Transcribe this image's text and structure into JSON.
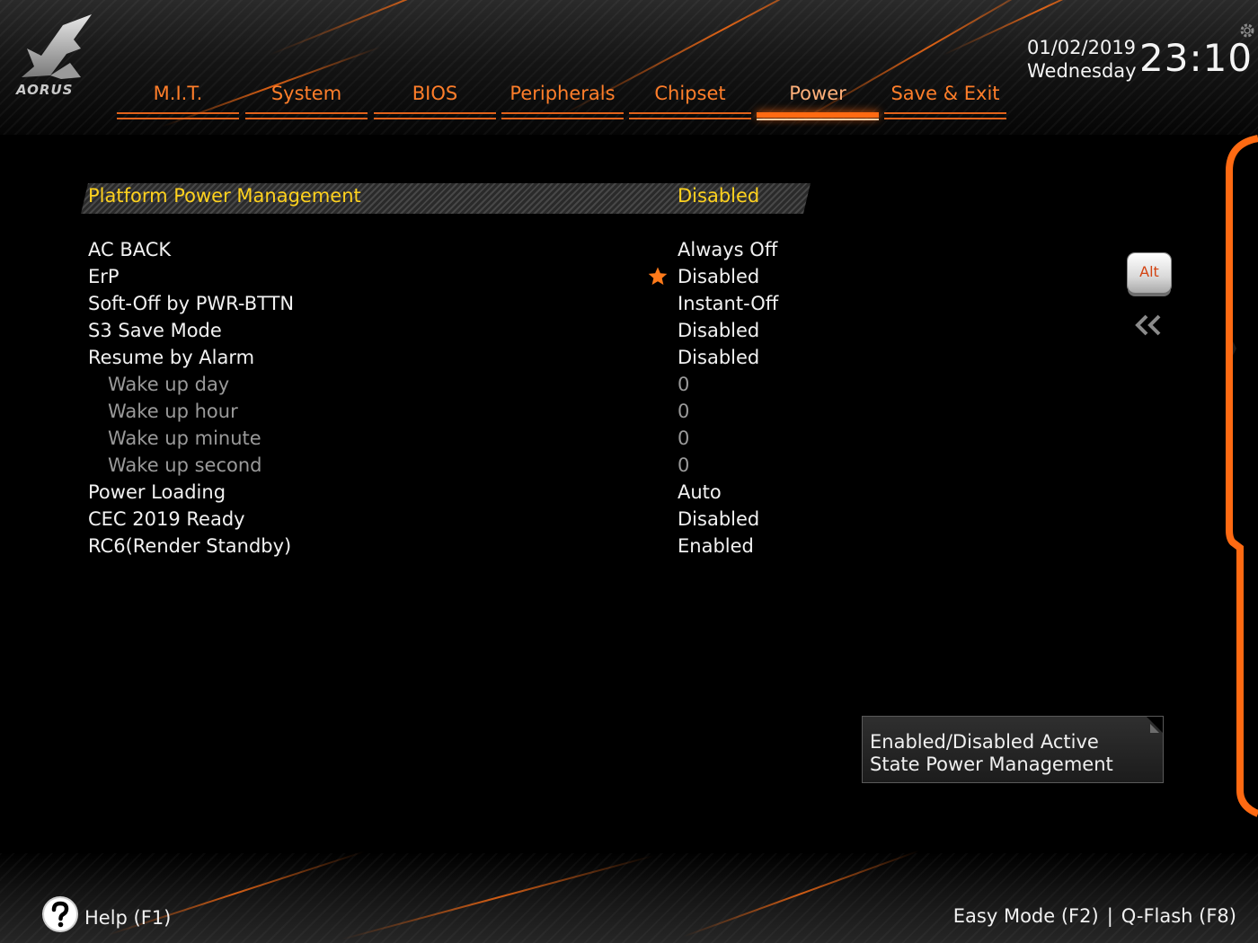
{
  "brand": {
    "logo_text": "AORUS"
  },
  "tabs": [
    {
      "label": "M.I.T.",
      "active": false
    },
    {
      "label": "System",
      "active": false
    },
    {
      "label": "BIOS",
      "active": false
    },
    {
      "label": "Peripherals",
      "active": false
    },
    {
      "label": "Chipset",
      "active": false
    },
    {
      "label": "Power",
      "active": true
    },
    {
      "label": "Save & Exit",
      "active": false
    }
  ],
  "clock": {
    "date": "01/02/2019",
    "weekday": "Wednesday",
    "time": "23:10"
  },
  "settings": [
    {
      "label": "Platform Power Management",
      "value": "Disabled",
      "selected": true
    },
    {
      "label": "AC BACK",
      "value": "Always Off"
    },
    {
      "label": "ErP",
      "value": "Disabled",
      "favorite": true
    },
    {
      "label": "Soft-Off by PWR-BTTN",
      "value": "Instant-Off"
    },
    {
      "label": "S3 Save Mode",
      "value": "Disabled"
    },
    {
      "label": "Resume by Alarm",
      "value": "Disabled"
    },
    {
      "label": "Wake up day",
      "value": "0",
      "disabled": true
    },
    {
      "label": "Wake up hour",
      "value": "0",
      "disabled": true
    },
    {
      "label": "Wake up minute",
      "value": "0",
      "disabled": true
    },
    {
      "label": "Wake up second",
      "value": "0",
      "disabled": true
    },
    {
      "label": "Power Loading",
      "value": "Auto"
    },
    {
      "label": "CEC 2019 Ready",
      "value": "Disabled"
    },
    {
      "label": "RC6(Render Standby)",
      "value": "Enabled"
    }
  ],
  "side": {
    "alt_key": "Alt"
  },
  "help_box": {
    "line1": "Enabled/Disabled Active",
    "line2": "State Power Management"
  },
  "footer": {
    "help": "Help (F1)",
    "easy_mode": "Easy Mode (F2)",
    "separator": "|",
    "qflash": "Q-Flash (F8)"
  },
  "colors": {
    "accent": "#ff6a12",
    "tab_text": "#ff7e2a",
    "selected_text": "#ffd21e",
    "disabled_text": "#9a9a9a",
    "background": "#000000"
  },
  "icons": [
    "aorus-logo-icon",
    "gear-icon",
    "star-icon",
    "double-chevron-left-icon",
    "help-icon"
  ]
}
